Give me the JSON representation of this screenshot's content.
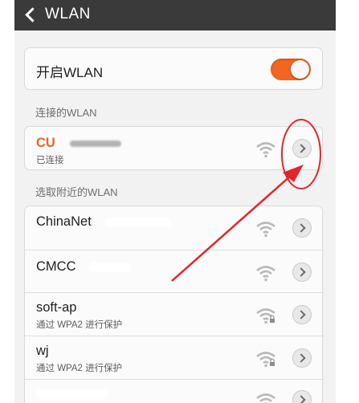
{
  "header": {
    "title": "WLAN"
  },
  "toggle": {
    "label": "开启WLAN",
    "enabled": true
  },
  "connected": {
    "section_title": "连接的WLAN",
    "network": {
      "ssid": "CU",
      "status": "已连接"
    }
  },
  "nearby": {
    "section_title": "选取附近的WLAN",
    "networks": [
      {
        "ssid": "ChinaNet",
        "status": "",
        "secured": false
      },
      {
        "ssid": "CMCC",
        "status": "",
        "secured": false
      },
      {
        "ssid": "soft-ap",
        "status": "通过 WPA2 进行保护",
        "secured": true
      },
      {
        "ssid": "wj",
        "status": "通过 WPA2 进行保护",
        "secured": true
      },
      {
        "ssid": "",
        "status": "",
        "secured": false
      }
    ]
  },
  "colors": {
    "accent": "#f26522",
    "annotation": "#e3242b",
    "topbar": "#3a3a3a"
  },
  "icons": {
    "wifi": "wifi-signal-icon",
    "locked_wifi": "wifi-lock-icon",
    "detail": "chevron-right-icon",
    "back": "back-arrow-icon"
  }
}
